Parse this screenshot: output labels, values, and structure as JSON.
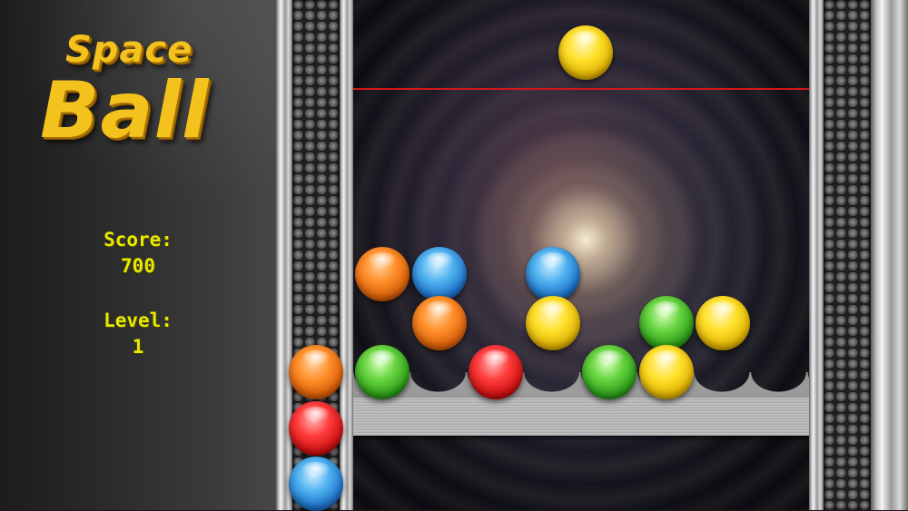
{
  "logo": {
    "line1": "Space",
    "line2": "Ball"
  },
  "stats": {
    "score_label": "Score:",
    "score_value": "700",
    "level_label": "Level:",
    "level_value": "1"
  },
  "colors": {
    "orange": "#ff8f2a",
    "blue": "#1b6fc6",
    "yellow": "#ffe02c",
    "green": "#299b17",
    "red": "#cc0f0f",
    "danger_line": "#d11818",
    "text_yellow": "#e8e800",
    "logo_gold": "#f4c21c"
  },
  "active_ball": {
    "color": "yellow"
  },
  "next_queue": [
    "orange",
    "red",
    "blue"
  ],
  "stack_rows": [
    [
      "orange",
      "blue",
      "empty",
      "blue",
      "empty",
      "empty",
      "empty",
      "empty"
    ],
    [
      "empty",
      "orange",
      "empty",
      "yellow",
      "empty",
      "green",
      "yellow",
      "empty"
    ],
    [
      "green",
      "empty",
      "red",
      "empty",
      "green",
      "yellow",
      "empty",
      "empty"
    ]
  ]
}
